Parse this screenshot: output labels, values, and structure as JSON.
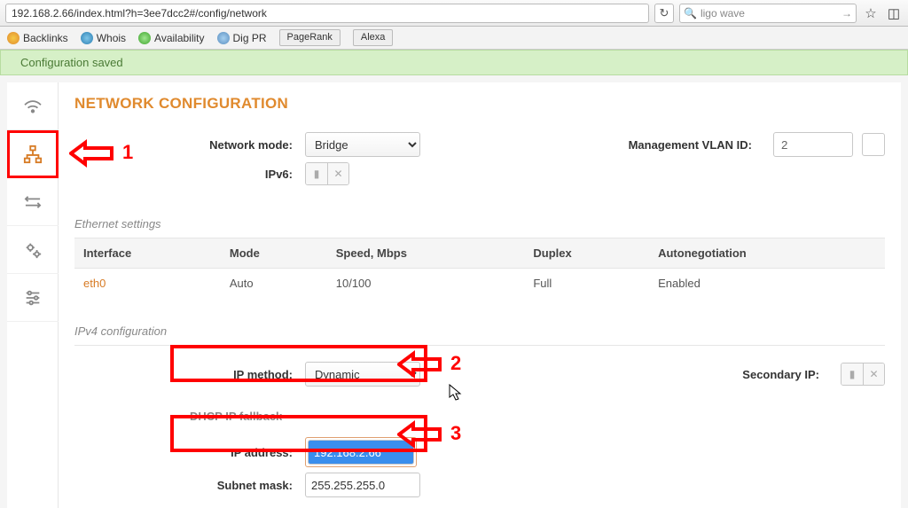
{
  "browser": {
    "url": "192.168.2.66/index.html?h=3ee7dcc2#/config/network",
    "search_value": "ligo wave"
  },
  "bookmarks": {
    "backlinks": "Backlinks",
    "whois": "Whois",
    "availability": "Availability",
    "digpr": "Dig PR",
    "pagerank": "PageRank",
    "alexa": "Alexa"
  },
  "banner": {
    "text": "Configuration saved"
  },
  "page": {
    "title": "NETWORK CONFIGURATION"
  },
  "form": {
    "network_mode_label": "Network mode:",
    "network_mode_value": "Bridge",
    "vlan_label": "Management VLAN ID:",
    "vlan_value": "2",
    "ipv6_label": "IPv6:",
    "ip_method_label": "IP method:",
    "ip_method_value": "Dynamic",
    "secondary_ip_label": "Secondary IP:",
    "dhcp_fallback_header": "DHCP IP fallback",
    "ip_address_label": "IP address:",
    "ip_address_value": "192.168.2.66",
    "subnet_label": "Subnet mask:",
    "subnet_value": "255.255.255.0"
  },
  "sections": {
    "ethernet": "Ethernet settings",
    "ipv4": "IPv4 configuration"
  },
  "eth_table": {
    "headers": {
      "interface": "Interface",
      "mode": "Mode",
      "speed": "Speed, Mbps",
      "duplex": "Duplex",
      "autoneg": "Autonegotiation"
    },
    "row": {
      "interface": "eth0",
      "mode": "Auto",
      "speed": "10/100",
      "duplex": "Full",
      "autoneg": "Enabled"
    }
  },
  "annotations": {
    "one": "1",
    "two": "2",
    "three": "3"
  }
}
